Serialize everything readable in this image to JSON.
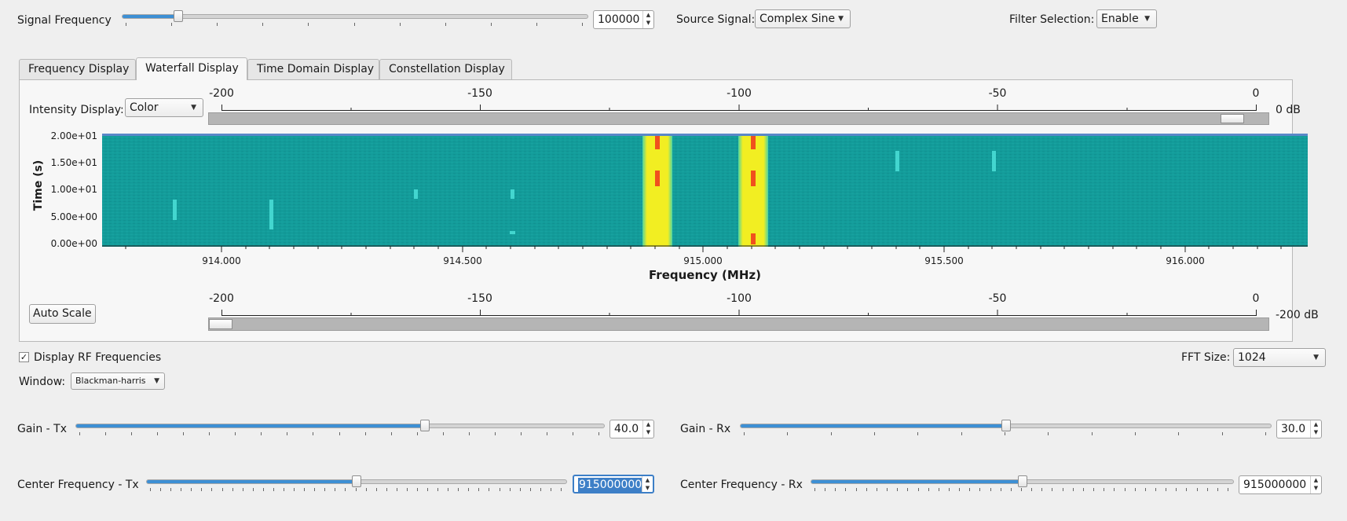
{
  "top": {
    "signal_frequency": {
      "label": "Signal Frequency",
      "value": "100000",
      "fraction": 0.12
    },
    "source_signal": {
      "label": "Source Signal:",
      "value": "Complex Sine"
    },
    "filter_selection": {
      "label": "Filter Selection:",
      "value": "Enable"
    }
  },
  "tabs": [
    {
      "label": "Frequency Display",
      "active": false
    },
    {
      "label": "Waterfall Display",
      "active": true
    },
    {
      "label": "Time Domain Display",
      "active": false
    },
    {
      "label": "Constellation Display",
      "active": false
    }
  ],
  "waterfall": {
    "intensity_label": "Intensity Display:",
    "intensity_value": "Color",
    "db_scale_ticks": [
      "-200",
      "-150",
      "-100",
      "-50",
      "0"
    ],
    "upper_db_label": "0 dB",
    "upper_fraction": 1.0,
    "lower_db_label": "-200 dB",
    "lower_fraction": 0.0,
    "auto_scale_label": "Auto Scale",
    "y_axis_label": "Time (s)",
    "y_ticks": [
      "2.00e+01",
      "1.50e+01",
      "1.00e+01",
      "5.00e+00",
      "0.00e+00"
    ],
    "x_axis_label": "Frequency (MHz)",
    "x_ticks": [
      "914.000",
      "914.500",
      "915.000",
      "915.500",
      "916.000"
    ],
    "colors": {
      "background": "#139c9a",
      "band": "#f2ee22",
      "hot": "#f0501d",
      "trace": "#43d6cf"
    }
  },
  "options": {
    "display_rf_label": "Display RF Frequencies",
    "display_rf_checked": "✓",
    "window_label": "Window:",
    "window_value": "Blackman-harris",
    "fft_label": "FFT Size:",
    "fft_value": "1024"
  },
  "gain_tx": {
    "label": "Gain - Tx",
    "value": "40.0",
    "fraction": 0.66
  },
  "gain_rx": {
    "label": "Gain - Rx",
    "value": "30.0",
    "fraction": 0.5
  },
  "center_tx": {
    "label": "Center Frequency - Tx",
    "value": "915000000",
    "fraction": 0.5
  },
  "center_rx": {
    "label": "Center Frequency - Rx",
    "value": "915000000",
    "fraction": 0.5
  }
}
